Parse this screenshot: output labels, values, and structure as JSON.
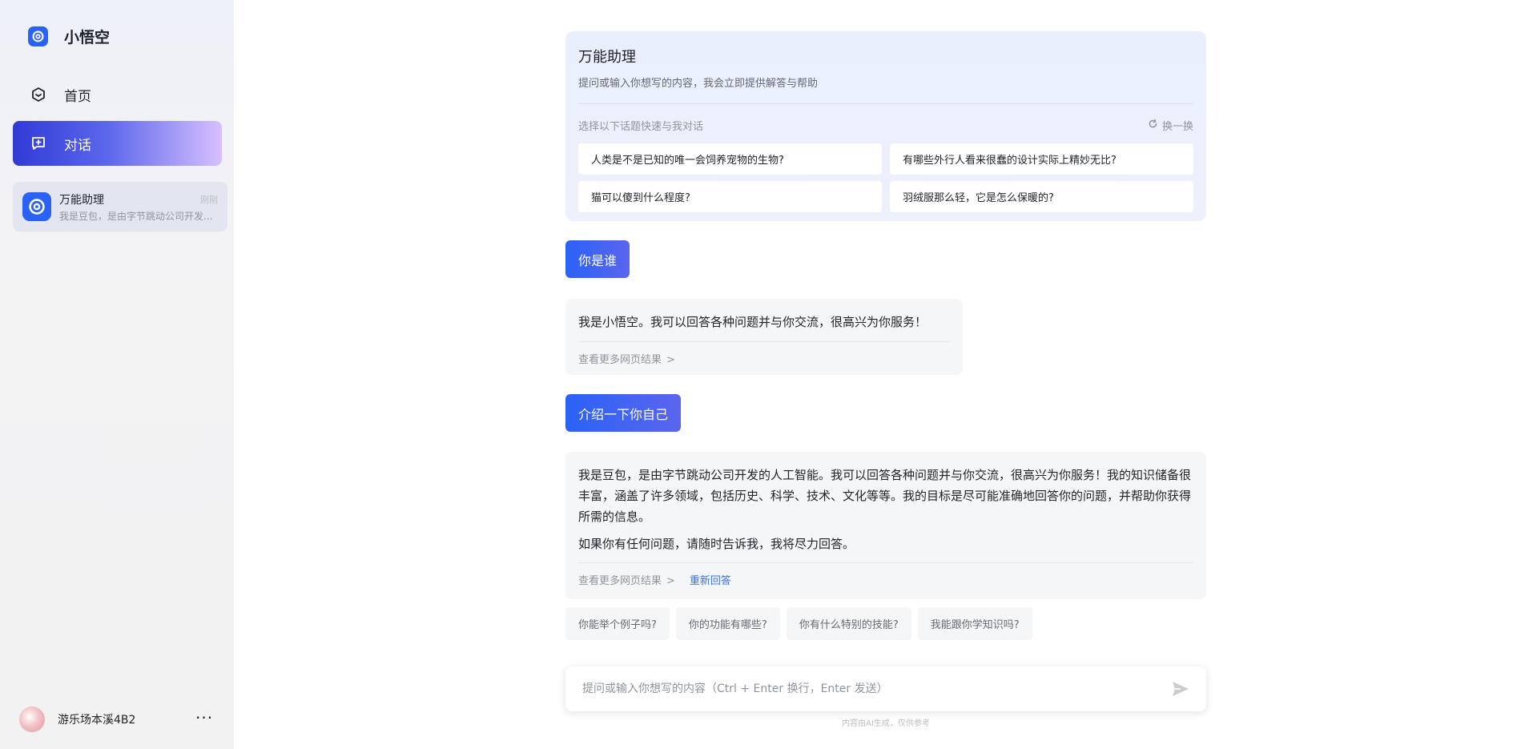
{
  "app": {
    "name": "小悟空",
    "brand_color": "#2a62f6",
    "accent_gradient": [
      "#2f3bd6",
      "#d7c0ff"
    ]
  },
  "nav": {
    "home": {
      "label": "首页",
      "icon": "home-icon"
    },
    "chat": {
      "label": "对话",
      "icon": "chat-icon",
      "active": true
    }
  },
  "conversation": {
    "title": "万能助理",
    "preview": "我是豆包，是由字节跳动公司开发...",
    "time": "刚刚"
  },
  "user": {
    "name": "游乐场本溪4B2"
  },
  "intro": {
    "title": "万能助理",
    "description": "提问或输入你想写的内容，我会立即提供解答与帮助",
    "hint": "选择以下话题快速与我对话",
    "refresh": "换一换",
    "suggestions": [
      "人类是不是已知的唯一会饲养宠物的生物?",
      "有哪些外行人看来很蠢的设计实际上精妙无比?",
      "猫可以傻到什么程度?",
      "羽绒服那么轻，它是怎么保暖的?"
    ]
  },
  "messages": {
    "user1": "你是谁",
    "bot1": "我是小悟空。我可以回答各种问题并与你交流，很高兴为你服务！",
    "user2": "介绍一下你自己",
    "bot2_p1": "我是豆包，是由字节跳动公司开发的人工智能。我可以回答各种问题并与你交流，很高兴为你服务！我的知识储备很丰富，涵盖了许多领域，包括历史、科学、技术、文化等等。我的目标是尽可能准确地回答你的问题，并帮助你获得所需的信息。",
    "bot2_p2": "如果你有任何问题，请随时告诉我，我将尽力回答。",
    "more_results": "查看更多网页结果",
    "regenerate": "重新回答"
  },
  "followups": [
    "你能举个例子吗?",
    "你的功能有哪些?",
    "你有什么特别的技能?",
    "我能跟你学知识吗?"
  ],
  "input": {
    "placeholder": "提问或输入你想写的内容（Ctrl + Enter 换行，Enter 发送）",
    "value": ""
  },
  "disclaimer": "内容由AI生成，仅供参考"
}
